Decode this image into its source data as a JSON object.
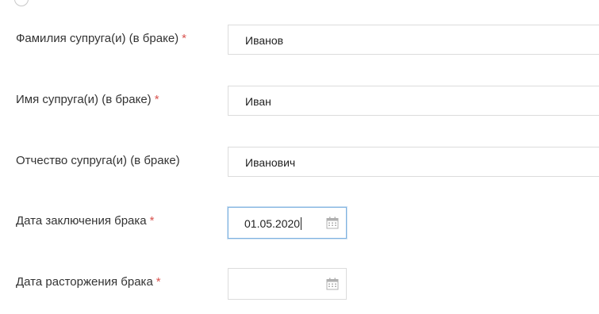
{
  "form": {
    "spouse_last_name": {
      "label": "Фамилия супруга(и) (в браке)",
      "required_mark": "*",
      "value": "Иванов"
    },
    "spouse_first_name": {
      "label": "Имя супруга(и) (в браке)",
      "required_mark": "*",
      "value": "Иван"
    },
    "spouse_patronymic": {
      "label": "Отчество супруга(и) (в браке)",
      "value": "Иванович"
    },
    "marriage_date": {
      "label": "Дата заключения брака",
      "required_mark": "*",
      "value": "01.05.2020",
      "icon": "calendar-icon"
    },
    "divorce_date": {
      "label": "Дата расторжения брака",
      "required_mark": "*",
      "value": "",
      "icon": "calendar-icon"
    }
  },
  "colors": {
    "required": "#d9534f",
    "focus_border": "#7fb2e0",
    "input_border": "#dcdcdc",
    "icon": "#b0b0b0"
  }
}
